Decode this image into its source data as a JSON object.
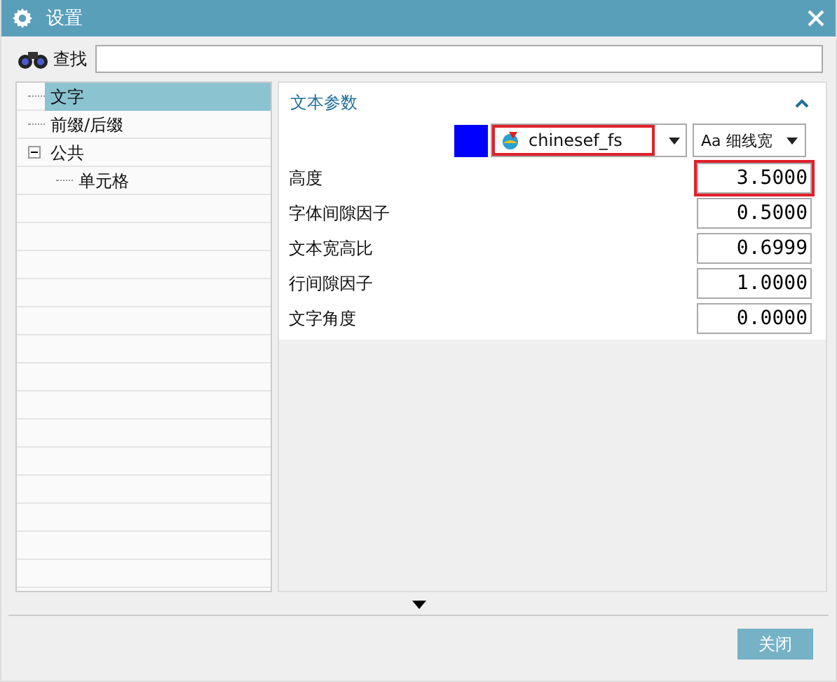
{
  "window": {
    "title": "设置"
  },
  "search": {
    "label": "查找"
  },
  "tree": [
    {
      "label": "文字",
      "selected": true
    },
    {
      "label": "前缀/后缀",
      "selected": false
    },
    {
      "label": "公共",
      "selected": false,
      "expanded": true,
      "children": [
        {
          "label": "单元格",
          "selected": false
        }
      ]
    }
  ],
  "panel": {
    "title": "文本参数",
    "expanded": true,
    "color": "#0000ff",
    "font": {
      "value": "chinesef_fs",
      "highlighted": true
    },
    "line_width": {
      "value": "Aa 细线宽"
    },
    "fields": [
      {
        "label": "高度",
        "value": "3.5000",
        "highlighted": true
      },
      {
        "label": "字体间隙因子",
        "value": "0.5000",
        "highlighted": false
      },
      {
        "label": "文本宽高比",
        "value": "0.6999",
        "highlighted": false
      },
      {
        "label": "行间隙因子",
        "value": "1.0000",
        "highlighted": false
      },
      {
        "label": "文字角度",
        "value": "0.0000",
        "highlighted": false
      }
    ]
  },
  "buttons": [
    "关闭"
  ]
}
